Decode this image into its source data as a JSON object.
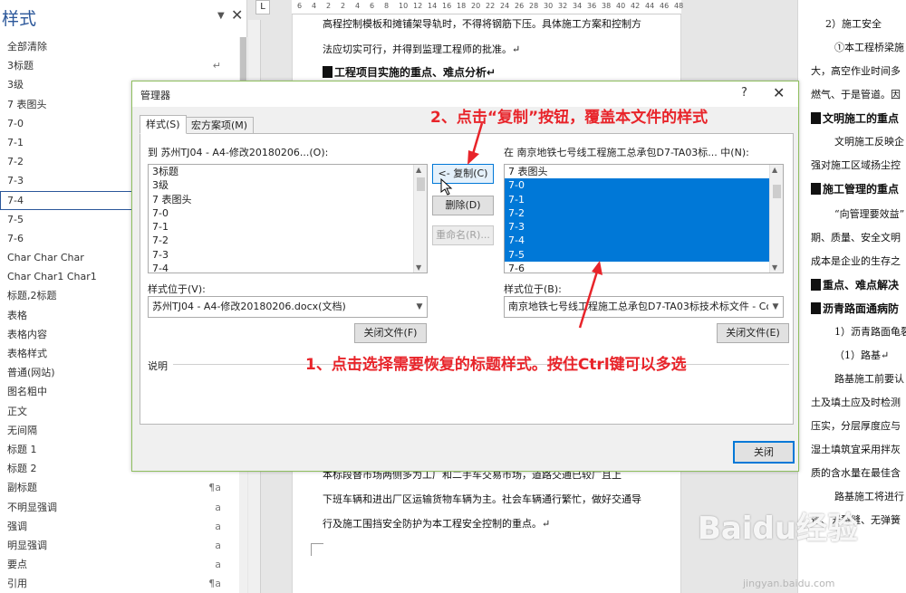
{
  "styles_pane": {
    "title": "样式",
    "items": [
      {
        "label": "全部清除",
        "mark": ""
      },
      {
        "label": "3标题",
        "mark": "↵"
      },
      {
        "label": "3级",
        "mark": ""
      },
      {
        "label": "7 表图头",
        "mark": ""
      },
      {
        "label": "7-0",
        "mark": ""
      },
      {
        "label": "7-1",
        "mark": ""
      },
      {
        "label": "7-2",
        "mark": ""
      },
      {
        "label": "7-3",
        "mark": ""
      },
      {
        "label": "7-4",
        "mark": ""
      },
      {
        "label": "7-5",
        "mark": ""
      },
      {
        "label": "7-6",
        "mark": ""
      },
      {
        "label": "Char Char Char",
        "mark": ""
      },
      {
        "label": "Char Char1 Char1",
        "mark": ""
      },
      {
        "label": "标题,2标题",
        "mark": ""
      },
      {
        "label": "表格",
        "mark": ""
      },
      {
        "label": "表格内容",
        "mark": ""
      },
      {
        "label": "表格样式",
        "mark": ""
      },
      {
        "label": "普通(网站)",
        "mark": ""
      },
      {
        "label": "图名粗中",
        "mark": ""
      },
      {
        "label": "正文",
        "mark": ""
      },
      {
        "label": "无间隔",
        "mark": ""
      },
      {
        "label": "标题 1",
        "mark": ""
      },
      {
        "label": "标题 2",
        "mark": ""
      },
      {
        "label": "副标题",
        "mark": "¶a"
      },
      {
        "label": "不明显强调",
        "mark": "a"
      },
      {
        "label": "强调",
        "mark": "a"
      },
      {
        "label": "明显强调",
        "mark": "a"
      },
      {
        "label": "要点",
        "mark": "a"
      },
      {
        "label": "引用",
        "mark": "¶a"
      }
    ],
    "selected_index": 8
  },
  "ruler": {
    "corner": "L",
    "ticks": [
      "6",
      "4",
      "2",
      "2",
      "4",
      "6",
      "8",
      "10",
      "12",
      "14",
      "16",
      "18",
      "20",
      "22",
      "24",
      "26",
      "28",
      "30",
      "32",
      "34",
      "36",
      "38",
      "40",
      "42",
      "44",
      "46",
      "48"
    ]
  },
  "document": {
    "lines": [
      "高程控制模板和摊铺架导轨时，不得将钢筋下压。具体施工方案和控制方",
      "法应切实可行，并得到监理工程师的批准。↵",
      "本标段替市场两侧多为工厂和二手车交易市场，道路交通已较广且上",
      "下班车辆和进出厂区运输货物车辆为主。社会车辆通行繁忙，做好交通导",
      "行及施工围挡安全防护为本工程安全控制的重点。↵"
    ],
    "heading": "工程项目实施的重点、难点分析↵",
    "right_lines": [
      "2）施工安全",
      "①本工程桥梁施",
      "大，高空作业时间多",
      "燃气、于是管道。因",
      "文明施工反映企",
      "强对施工区域扬尘控",
      "“向管理要效益”",
      "期、质量、安全文明",
      "成本是企业的生存之",
      "1）沥青路面龟裂",
      "（1）路基↵",
      "路基施工前要认",
      "土及填土应及时检测",
      "压实，分层厚度应与",
      "湿土填筑宜采用拌灰",
      "质的含水量在最佳含",
      "路基施工将进行",
      "迹、无裂缝、无弹簧"
    ],
    "right_headings": [
      "文明施工的重点",
      "施工管理的重点",
      "重点、难点解决",
      "沥青路面通病防"
    ]
  },
  "dialog": {
    "title": "管理器",
    "help": "?",
    "close_x": "✕",
    "tabs": [
      "样式(S)",
      "宏方案项(M)"
    ],
    "left": {
      "label": "到 苏州TJ04 - A4-修改20180206...(O):",
      "items": [
        "3标题",
        "3级",
        "7 表图头",
        "7-0",
        "7-1",
        "7-2",
        "7-3",
        "7-4"
      ],
      "styles_in_label": "样式位于(V):",
      "styles_in_value": "苏州TJ04 - A4-修改20180206.docx(文档)",
      "close_file": "关闭文件(F)"
    },
    "right": {
      "label": "在 南京地铁七号线工程施工总承包D7-TA03标... 中(N):",
      "items": [
        "7 表图头",
        "7-0",
        "7-1",
        "7-2",
        "7-3",
        "7-4",
        "7-5",
        "7-6"
      ],
      "selected": [
        1,
        2,
        3,
        4,
        5,
        6
      ],
      "styles_in_label": "样式位于(B):",
      "styles_in_value": "南京地铁七号线工程施工总承包D7-TA03标技术标文件 - Copy",
      "close_file": "关闭文件(E)"
    },
    "buttons": {
      "copy": "<- 复制(C)",
      "delete": "删除(D)",
      "rename": "重命名(R)..."
    },
    "description_label": "说明",
    "close_button": "关闭"
  },
  "annotations": {
    "step2": "2、点击“复制”按钮，覆盖本文件的样式",
    "step1": "1、点击选择需要恢复的标题样式。按住Ctrl键可以多选",
    "color": "#e8242a"
  },
  "watermark": {
    "brand": "Baidu经验",
    "url": "jingyan.baidu.com"
  }
}
